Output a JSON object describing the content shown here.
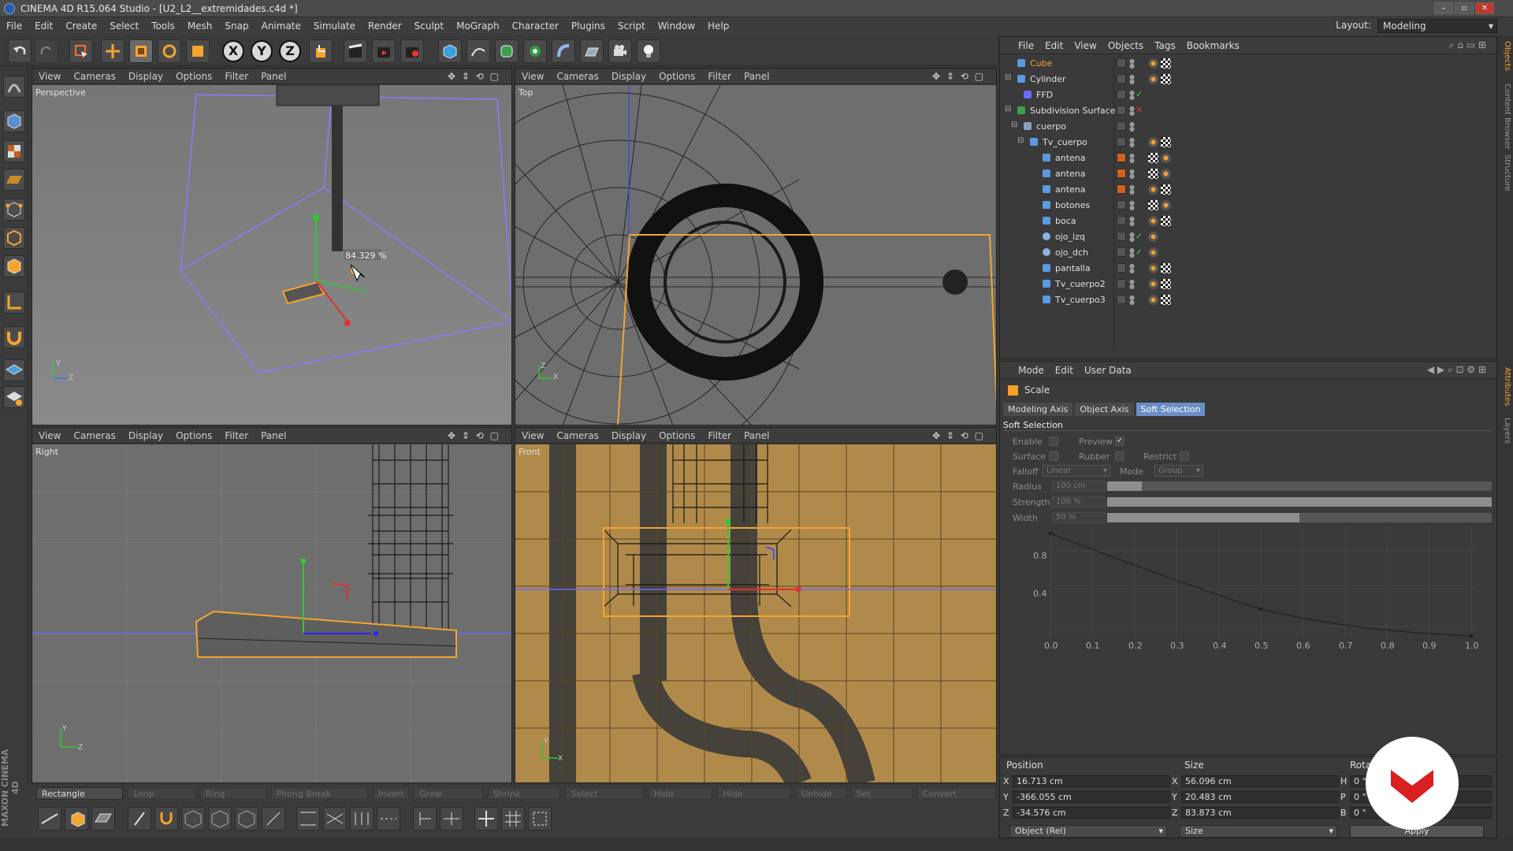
{
  "window": {
    "title": "CINEMA 4D R15.064 Studio - [U2_L2__extremidades.c4d *]"
  },
  "menu": [
    "File",
    "Edit",
    "Create",
    "Select",
    "Tools",
    "Mesh",
    "Snap",
    "Animate",
    "Simulate",
    "Render",
    "Sculpt",
    "MoGraph",
    "Character",
    "Plugins",
    "Script",
    "Window",
    "Help"
  ],
  "layout": {
    "label": "Layout:",
    "value": "Modeling"
  },
  "viewport_menu": [
    "View",
    "Cameras",
    "Display",
    "Options",
    "Filter",
    "Panel"
  ],
  "viewports": {
    "perspective": {
      "name": "Perspective",
      "scale_readout": "84.329 %"
    },
    "top": {
      "name": "Top"
    },
    "right": {
      "name": "Right"
    },
    "front": {
      "name": "Front"
    }
  },
  "axis_labels": {
    "y": "Y",
    "z": "Z",
    "x": "X"
  },
  "xyz_buttons": [
    "X",
    "Y",
    "Z"
  ],
  "selection_bar": [
    "Rectangle Selection",
    "Loop Selection",
    "Ring Selection",
    "Phong Break Selection",
    "Invert",
    "Grow Selection",
    "Shrink Selection",
    "Select Connected",
    "Hide Selected",
    "Hide Unselected",
    "Unhide All",
    "Set Selection",
    "Convert Selection"
  ],
  "brand": "MAXON CINEMA 4D",
  "object_manager": {
    "menu": [
      "File",
      "Edit",
      "View",
      "Objects",
      "Tags",
      "Bookmarks"
    ],
    "objects": [
      {
        "name": "Cube",
        "selected": true
      },
      {
        "name": "Cylinder"
      },
      {
        "name": "FFD"
      },
      {
        "name": "Subdivision Surface"
      },
      {
        "name": "cuerpo"
      },
      {
        "name": "Tv_cuerpo"
      },
      {
        "name": "antena"
      },
      {
        "name": "antena"
      },
      {
        "name": "antena"
      },
      {
        "name": "botones"
      },
      {
        "name": "boca"
      },
      {
        "name": "ojo_izq"
      },
      {
        "name": "ojo_dch"
      },
      {
        "name": "pantalla"
      },
      {
        "name": "Tv_cuerpo2"
      },
      {
        "name": "Tv_cuerpo3"
      }
    ]
  },
  "side_tabs": [
    "Objects",
    "Content Browser",
    "Structure",
    "Attributes",
    "Layers"
  ],
  "attributes": {
    "menu": [
      "Mode",
      "Edit",
      "User Data"
    ],
    "tool": "Scale",
    "tabs": [
      "Modeling Axis",
      "Object Axis",
      "Soft Selection"
    ],
    "active_tab": "Soft Selection",
    "section": "Soft Selection",
    "enable": "Enable",
    "preview": "Preview",
    "preview_checked": true,
    "surface": "Surface",
    "rubber": "Rubber",
    "restrict": "Restrict",
    "falloff_label": "Falloff",
    "falloff_value": "Linear",
    "mode_label": "Mode",
    "mode_value": "Group",
    "radius_label": "Radius",
    "radius_value": "100 cm",
    "radius_level": 0.09,
    "strength_label": "Strength",
    "strength_value": "100 %",
    "strength_level": 1.0,
    "width_label": "Width",
    "width_value": "50 %",
    "width_level": 0.5,
    "graph_y_ticks": [
      "0.8",
      "0.4"
    ],
    "graph_x_ticks": [
      "0.0",
      "0.1",
      "0.2",
      "0.3",
      "0.4",
      "0.5",
      "0.6",
      "0.7",
      "0.8",
      "0.9",
      "1.0"
    ]
  },
  "coordinates": {
    "headers": {
      "position": "Position",
      "size": "Size",
      "rotation": "Rotation"
    },
    "position": [
      {
        "axis": "X",
        "value": "16.713 cm"
      },
      {
        "axis": "Y",
        "value": "-366.055 cm"
      },
      {
        "axis": "Z",
        "value": "-34.576 cm"
      }
    ],
    "size": [
      {
        "axis": "X",
        "value": "56.096 cm"
      },
      {
        "axis": "Y",
        "value": "20.483 cm"
      },
      {
        "axis": "Z",
        "value": "83.873 cm"
      }
    ],
    "rotation": [
      {
        "axis": "H",
        "value": "0 °"
      },
      {
        "axis": "P",
        "value": "0 °"
      },
      {
        "axis": "B",
        "value": "0 °"
      }
    ],
    "mode_dropdown": "Object (Rel)",
    "size_dropdown": "Size",
    "apply": "Apply"
  },
  "colors": {
    "selection_orange": "#f0a21e",
    "tab_active": "#6a8fc6",
    "logo_red": "#d8201f"
  }
}
